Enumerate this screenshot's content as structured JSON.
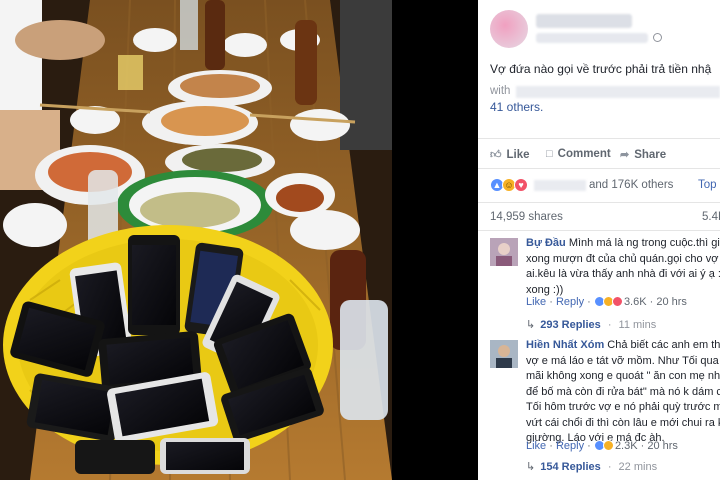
{
  "post": {
    "text": "Vợ đứa nào gọi về trước phải trả tiền nhậ",
    "with_label": "with",
    "others_link": "41 others."
  },
  "actions": {
    "like": "Like",
    "comment": "Comment",
    "share": "Share"
  },
  "reactions": {
    "summary": "and 176K others",
    "top_comments": "Top C"
  },
  "stats": {
    "shares": "14,959 shares",
    "right": "5.4K"
  },
  "comments": [
    {
      "name": "Bự Đầu",
      "lines": [
        "Mình má là ng trong cuộc.thì giả",
        "xong mượn đt của chủ quán.gọi cho vợ c",
        "ai.kêu là vừa thấy anh nhà đi với ai ý ạ :))",
        "xong :))"
      ],
      "like": "Like",
      "reply": "Reply",
      "count": "3.6K",
      "time": "20 hrs",
      "replies": "293 Replies",
      "replies_time": "11 mins"
    },
    {
      "name": "Hiền Nhất Xóm",
      "lines": [
        "Chả biết các anh em thế",
        "vợ e má láo e tát vỡ mồm. Như Tối qua ăn",
        "mãi không xong e quoát \" ăn con mẹ nhà",
        "để bố mà còn đi rửa bát\" mà nó k dám cã",
        "Tối hôm trước vợ e nó phải quỳ trước mặ",
        "vứt cái chổi đi thì còn lâu e mới chui ra kh",
        "giường. Láo với e má đc àh."
      ],
      "like": "Like",
      "reply": "Reply",
      "count": "2.3K",
      "time": "20 hrs",
      "replies": "154 Replies",
      "replies_time": "22 mins"
    }
  ],
  "colors": {
    "fb_blue": "#365899",
    "link_blue": "#4267b2",
    "like_blue": "#5890ff",
    "love_red": "#f25268",
    "haha_yellow": "#f7b125",
    "basket_yellow": "#f2d21a"
  },
  "icons": {
    "globe": "globe-icon",
    "like": "thumbs-up-icon",
    "comment": "speech-bubble-icon",
    "share": "share-arrow-icon"
  }
}
